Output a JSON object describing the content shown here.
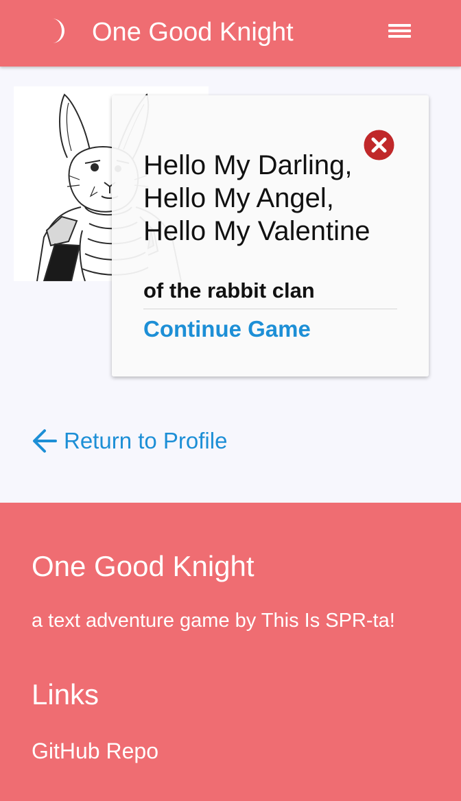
{
  "header": {
    "logo_icon": "crescent-moon-icon",
    "title": "One Good Knight",
    "menu_icon": "hamburger-menu-icon",
    "background": "#ef6d72"
  },
  "character": {
    "portrait": "rabbit-knight-sketch",
    "name": "Hello My Darling, Hello My Angel, Hello My Valentine",
    "clan": "of the rabbit clan",
    "close_icon": "close-circle-icon",
    "continue_label": "Continue Game"
  },
  "navigation": {
    "back_icon": "arrow-left-icon",
    "return_label": "Return to Profile"
  },
  "footer": {
    "title": "One Good Knight",
    "description": "a text adventure game by This Is SPR-ta!",
    "links_heading": "Links",
    "links": [
      {
        "label": "GitHub Repo"
      }
    ]
  },
  "colors": {
    "brand": "#ef6d72",
    "link": "#1d8fd6",
    "close": "#c0282a",
    "page_background": "#f7f7fd"
  }
}
